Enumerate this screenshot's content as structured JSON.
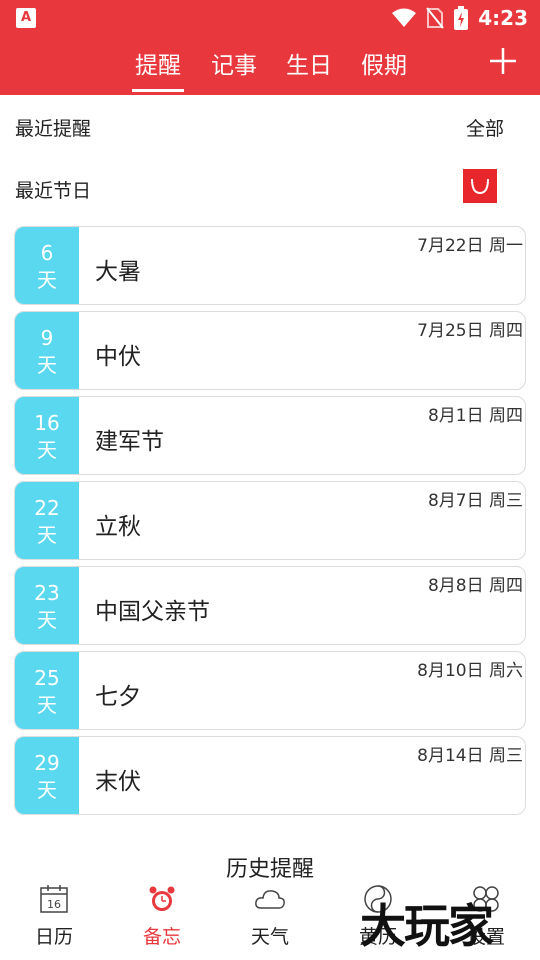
{
  "status_bar": {
    "time": "4:23",
    "app_badge": "A"
  },
  "tabs": [
    {
      "label": "提醒",
      "active": true
    },
    {
      "label": "记事",
      "active": false
    },
    {
      "label": "生日",
      "active": false
    },
    {
      "label": "假期",
      "active": false
    }
  ],
  "sections": {
    "recent_reminders": "最近提醒",
    "all_link": "全部",
    "recent_holidays": "最近节日"
  },
  "holidays": [
    {
      "days": "6",
      "unit": "天",
      "name": "大暑",
      "date": "7月22日 周一"
    },
    {
      "days": "9",
      "unit": "天",
      "name": "中伏",
      "date": "7月25日 周四"
    },
    {
      "days": "16",
      "unit": "天",
      "name": "建军节",
      "date": "8月1日 周四"
    },
    {
      "days": "22",
      "unit": "天",
      "name": "立秋",
      "date": "8月7日 周三"
    },
    {
      "days": "23",
      "unit": "天",
      "name": "中国父亲节",
      "date": "8月8日 周四"
    },
    {
      "days": "25",
      "unit": "天",
      "name": "七夕",
      "date": "8月10日 周六"
    },
    {
      "days": "29",
      "unit": "天",
      "name": "末伏",
      "date": "8月14日 周三"
    }
  ],
  "history_link": "历史提醒",
  "bottom_nav": [
    {
      "label": "日历",
      "icon": "calendar-icon",
      "icon_text": "16"
    },
    {
      "label": "备忘",
      "icon": "alarm-clock-icon",
      "active": true
    },
    {
      "label": "天气",
      "icon": "cloud-icon"
    },
    {
      "label": "黄历",
      "icon": "almanac-icon"
    },
    {
      "label": "设置",
      "icon": "settings-icon"
    }
  ],
  "watermark": "大玩家",
  "colors": {
    "accent": "#e8383d",
    "days_block": "#5ad8ef",
    "toggle": "#e8272c"
  }
}
